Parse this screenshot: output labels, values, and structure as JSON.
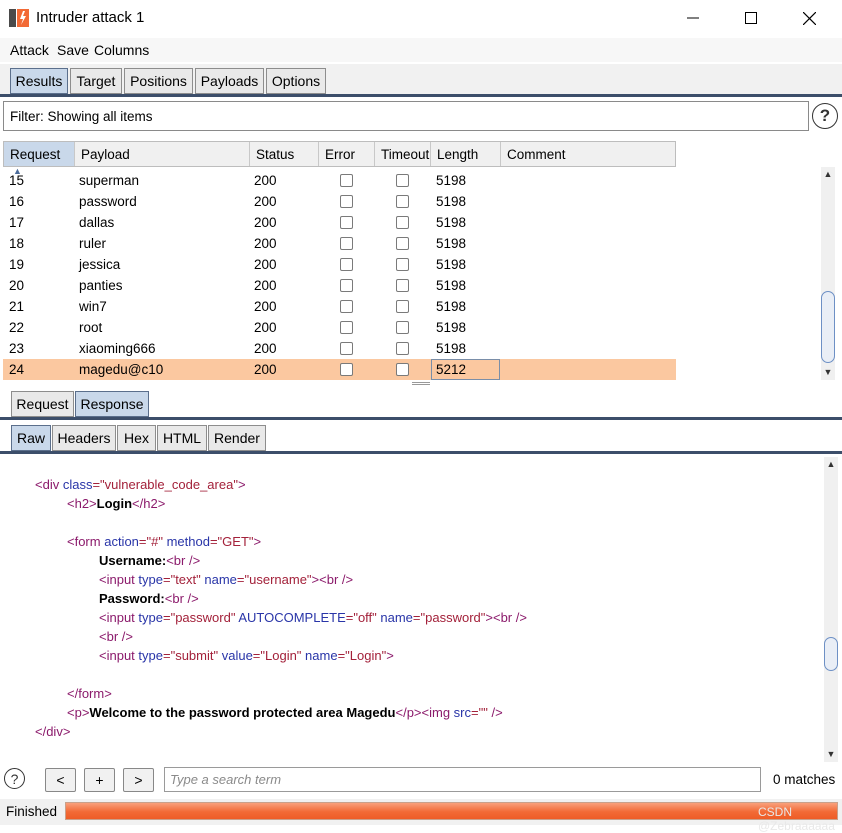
{
  "window": {
    "title": "Intruder attack 1"
  },
  "menu": [
    "Attack",
    "Save",
    "Columns"
  ],
  "top_tabs": [
    "Results",
    "Target",
    "Positions",
    "Payloads",
    "Options"
  ],
  "filter": {
    "text": "Filter: Showing all items"
  },
  "help_glyph": "?",
  "table": {
    "columns": [
      "Request",
      "Payload",
      "Status",
      "Error",
      "Timeout",
      "Length",
      "Comment"
    ],
    "sort_glyph": "▲",
    "rows": [
      {
        "request": "15",
        "payload": "superman",
        "status": "200",
        "length": "5198",
        "error": false,
        "timeout": false,
        "selected": false
      },
      {
        "request": "16",
        "payload": "password",
        "status": "200",
        "length": "5198",
        "error": false,
        "timeout": false,
        "selected": false
      },
      {
        "request": "17",
        "payload": "dallas",
        "status": "200",
        "length": "5198",
        "error": false,
        "timeout": false,
        "selected": false
      },
      {
        "request": "18",
        "payload": "ruler",
        "status": "200",
        "length": "5198",
        "error": false,
        "timeout": false,
        "selected": false
      },
      {
        "request": "19",
        "payload": "jessica",
        "status": "200",
        "length": "5198",
        "error": false,
        "timeout": false,
        "selected": false
      },
      {
        "request": "20",
        "payload": "panties",
        "status": "200",
        "length": "5198",
        "error": false,
        "timeout": false,
        "selected": false
      },
      {
        "request": "21",
        "payload": "win7",
        "status": "200",
        "length": "5198",
        "error": false,
        "timeout": false,
        "selected": false
      },
      {
        "request": "22",
        "payload": "root",
        "status": "200",
        "length": "5198",
        "error": false,
        "timeout": false,
        "selected": false
      },
      {
        "request": "23",
        "payload": "xiaoming666",
        "status": "200",
        "length": "5198",
        "error": false,
        "timeout": false,
        "selected": false
      },
      {
        "request": "24",
        "payload": "magedu@c10",
        "status": "200",
        "length": "5212",
        "error": false,
        "timeout": false,
        "selected": true
      }
    ]
  },
  "mid_tabs": [
    "Request",
    "Response"
  ],
  "sub_tabs": [
    "Raw",
    "Headers",
    "Hex",
    "HTML",
    "Render"
  ],
  "code": {
    "lines": [
      [
        {
          "t": "<div ",
          "c": "tag"
        },
        {
          "t": "class",
          "c": "attr"
        },
        {
          "t": "=\"vulnerable_code_area\"",
          "c": "val"
        },
        {
          "t": ">",
          "c": "tag"
        }
      ],
      [
        {
          "t": "<h2>",
          "c": "tag"
        },
        {
          "t": "Login",
          "c": "bold"
        },
        {
          "t": "</h2>",
          "c": "tag"
        }
      ],
      [],
      [
        {
          "t": "<form ",
          "c": "tag"
        },
        {
          "t": "action",
          "c": "attr"
        },
        {
          "t": "=\"#\" ",
          "c": "val"
        },
        {
          "t": "method",
          "c": "attr"
        },
        {
          "t": "=\"GET\"",
          "c": "val"
        },
        {
          "t": ">",
          "c": "tag"
        }
      ],
      [
        {
          "t": "Username:",
          "c": "bold"
        },
        {
          "t": "<br />",
          "c": "tag"
        }
      ],
      [
        {
          "t": "<input ",
          "c": "tag"
        },
        {
          "t": "type",
          "c": "attr"
        },
        {
          "t": "=\"text\" ",
          "c": "val"
        },
        {
          "t": "name",
          "c": "attr"
        },
        {
          "t": "=\"username\"",
          "c": "val"
        },
        {
          "t": "><br />",
          "c": "tag"
        }
      ],
      [
        {
          "t": "Password:",
          "c": "bold"
        },
        {
          "t": "<br />",
          "c": "tag"
        }
      ],
      [
        {
          "t": "<input ",
          "c": "tag"
        },
        {
          "t": "type",
          "c": "attr"
        },
        {
          "t": "=\"password\" ",
          "c": "val"
        },
        {
          "t": "AUTOCOMPLETE",
          "c": "attr"
        },
        {
          "t": "=\"off\" ",
          "c": "val"
        },
        {
          "t": "name",
          "c": "attr"
        },
        {
          "t": "=\"password\"",
          "c": "val"
        },
        {
          "t": "><br />",
          "c": "tag"
        }
      ],
      [
        {
          "t": "<br />",
          "c": "tag"
        }
      ],
      [
        {
          "t": "<input ",
          "c": "tag"
        },
        {
          "t": "type",
          "c": "attr"
        },
        {
          "t": "=\"submit\" ",
          "c": "val"
        },
        {
          "t": "value",
          "c": "attr"
        },
        {
          "t": "=\"Login\" ",
          "c": "val"
        },
        {
          "t": "name",
          "c": "attr"
        },
        {
          "t": "=\"Login\"",
          "c": "val"
        },
        {
          "t": ">",
          "c": "tag"
        }
      ],
      [],
      [
        {
          "t": "</form>",
          "c": "tag"
        }
      ],
      [
        {
          "t": "<p>",
          "c": "tag"
        },
        {
          "t": "Welcome to the password protected area Magedu",
          "c": "bold"
        },
        {
          "t": "</p><img ",
          "c": "tag"
        },
        {
          "t": "src",
          "c": "attr"
        },
        {
          "t": "=\"\" ",
          "c": "val"
        },
        {
          "t": "/>",
          "c": "tag"
        }
      ],
      [
        {
          "t": "</div>",
          "c": "tag"
        }
      ]
    ]
  },
  "search": {
    "buttons": [
      "<",
      "+",
      ">"
    ],
    "placeholder": "Type a search term",
    "matches": "0 matches"
  },
  "status": {
    "text": "Finished",
    "progress": 1.0,
    "watermark": "CSDN @Zebraaaaaa"
  },
  "colors": {
    "selected_row": "#fbc8a0",
    "progress": "#f26a36",
    "tab_active": "#c9d8ea",
    "tag": "#8b1a6b",
    "attr": "#2935a8",
    "value": "#a3213a"
  }
}
